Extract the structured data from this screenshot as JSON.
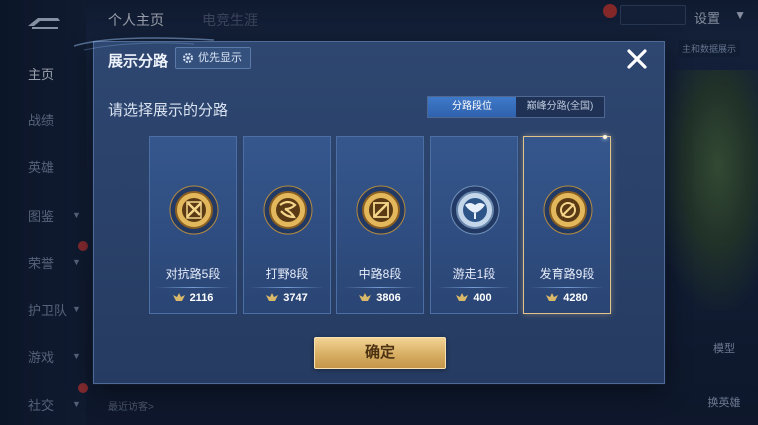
{
  "background": {
    "sidebar": {
      "items": [
        {
          "label": "主页",
          "active": true
        },
        {
          "label": "战绩"
        },
        {
          "label": "英雄"
        },
        {
          "label": "图鉴"
        },
        {
          "label": "荣誉"
        },
        {
          "label": "护卫队"
        },
        {
          "label": "游戏"
        },
        {
          "label": "社交"
        }
      ]
    },
    "topbar": {
      "tab_profile": "个人主页",
      "tab_other": "电竞生涯",
      "settings_label": "设置"
    },
    "side_note": "主和数据展示",
    "right_buttons": [
      "模型",
      "换英雄"
    ],
    "visitor_label": "最近访客>"
  },
  "modal": {
    "title": "展示分路",
    "priority_button": "优先显示",
    "choose_label": "请选择展示的分路",
    "toggle": {
      "options": [
        "分路段位",
        "巅峰分路(全国)"
      ],
      "active_index": 0
    },
    "cards": [
      {
        "lane": "对抗路5段",
        "score": "2116",
        "selected": false,
        "emblem": "sword-icon"
      },
      {
        "lane": "打野8段",
        "score": "3747",
        "selected": false,
        "emblem": "dragon-icon"
      },
      {
        "lane": "中路8段",
        "score": "3806",
        "selected": false,
        "emblem": "slash-icon"
      },
      {
        "lane": "游走1段",
        "score": "400",
        "selected": false,
        "emblem": "wings-icon"
      },
      {
        "lane": "发育路9段",
        "score": "4280",
        "selected": true,
        "emblem": "target-icon"
      }
    ],
    "confirm_label": "确定"
  },
  "colors": {
    "gold_accent": "#d7ae63",
    "toggle_active": "#3f79c9",
    "modal_bg": "#2a4169"
  }
}
